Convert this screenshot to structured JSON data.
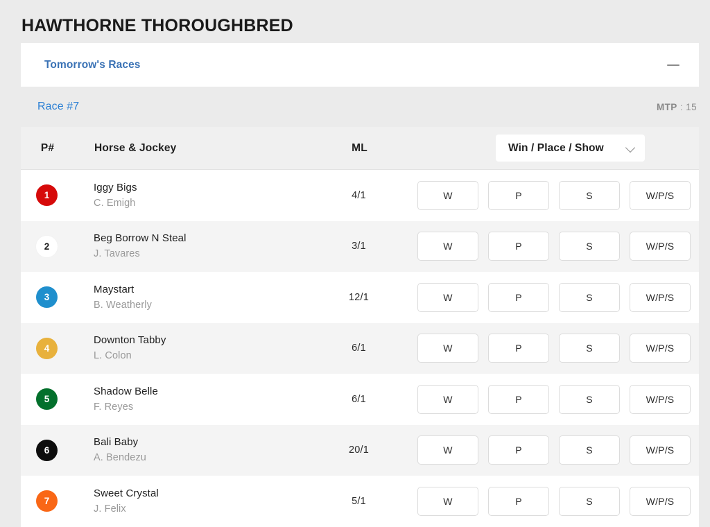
{
  "page": {
    "title": "HAWTHORNE THOROUGHBRED"
  },
  "accordion": {
    "title": "Tomorrow's Races",
    "collapse_icon": "minus-icon"
  },
  "race": {
    "label": "Race #7",
    "mtp_key": "MTP",
    "mtp_separator": ":",
    "mtp_value": "15"
  },
  "table": {
    "headers": {
      "pnum": "P#",
      "horse_jockey": "Horse & Jockey",
      "ml": "ML"
    },
    "bet_type_dropdown": {
      "selected": "Win / Place / Show",
      "chevron_icon": "chevron-down-icon"
    },
    "bet_buttons": [
      "W",
      "P",
      "S",
      "W/P/S"
    ],
    "rows": [
      {
        "pnum": "1",
        "badge_color": "#d60a0a",
        "badge_text_color": "#ffffff",
        "horse": "Iggy Bigs",
        "jockey": "C. Emigh",
        "ml": "4/1"
      },
      {
        "pnum": "2",
        "badge_color": "#ffffff",
        "badge_text_color": "#1a1a1a",
        "horse": "Beg Borrow N Steal",
        "jockey": "J. Tavares",
        "ml": "3/1"
      },
      {
        "pnum": "3",
        "badge_color": "#1f8fcd",
        "badge_text_color": "#ffffff",
        "horse": "Maystart",
        "jockey": "B. Weatherly",
        "ml": "12/1"
      },
      {
        "pnum": "4",
        "badge_color": "#e8b13c",
        "badge_text_color": "#ffffff",
        "horse": "Downton Tabby",
        "jockey": "L. Colon",
        "ml": "6/1"
      },
      {
        "pnum": "5",
        "badge_color": "#03702c",
        "badge_text_color": "#ffffff",
        "horse": "Shadow Belle",
        "jockey": "F. Reyes",
        "ml": "6/1"
      },
      {
        "pnum": "6",
        "badge_color": "#0d0d0d",
        "badge_text_color": "#ffffff",
        "horse": "Bali Baby",
        "jockey": "A. Bendezu",
        "ml": "20/1"
      },
      {
        "pnum": "7",
        "badge_color": "#f96716",
        "badge_text_color": "#ffffff",
        "horse": "Sweet Crystal",
        "jockey": "J. Felix",
        "ml": "5/1"
      }
    ]
  },
  "colors": {
    "page_background": "#ebebeb",
    "card_background": "#ffffff",
    "row_alt_background": "#f4f4f4",
    "header_background": "#f0f0f0",
    "link_blue": "#2a7fd4",
    "accordion_blue": "#3a72b5"
  }
}
